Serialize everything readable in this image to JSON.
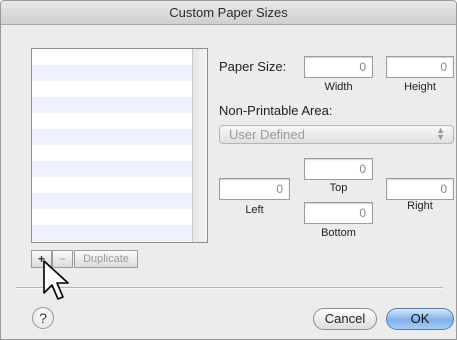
{
  "window": {
    "title": "Custom Paper Sizes"
  },
  "paper_size": {
    "label": "Paper Size:",
    "width_value": "0",
    "height_value": "0",
    "width_label": "Width",
    "height_label": "Height"
  },
  "non_printable": {
    "label": "Non-Printable Area:",
    "popup_value": "User Defined",
    "top_value": "0",
    "left_value": "0",
    "right_value": "0",
    "bottom_value": "0",
    "top_label": "Top",
    "left_label": "Left",
    "right_label": "Right",
    "bottom_label": "Bottom"
  },
  "list_controls": {
    "plus": "+",
    "minus": "−",
    "duplicate": "Duplicate"
  },
  "footer": {
    "help": "?",
    "cancel": "Cancel",
    "ok": "OK"
  },
  "icons": {
    "help": "question-mark-icon",
    "popup_arrows": "up-down-arrows-icon",
    "cursor": "arrow-pointer-icon"
  },
  "colors": {
    "ok_button": "#7fb2ea",
    "list_stripe": "#edf3fe"
  }
}
